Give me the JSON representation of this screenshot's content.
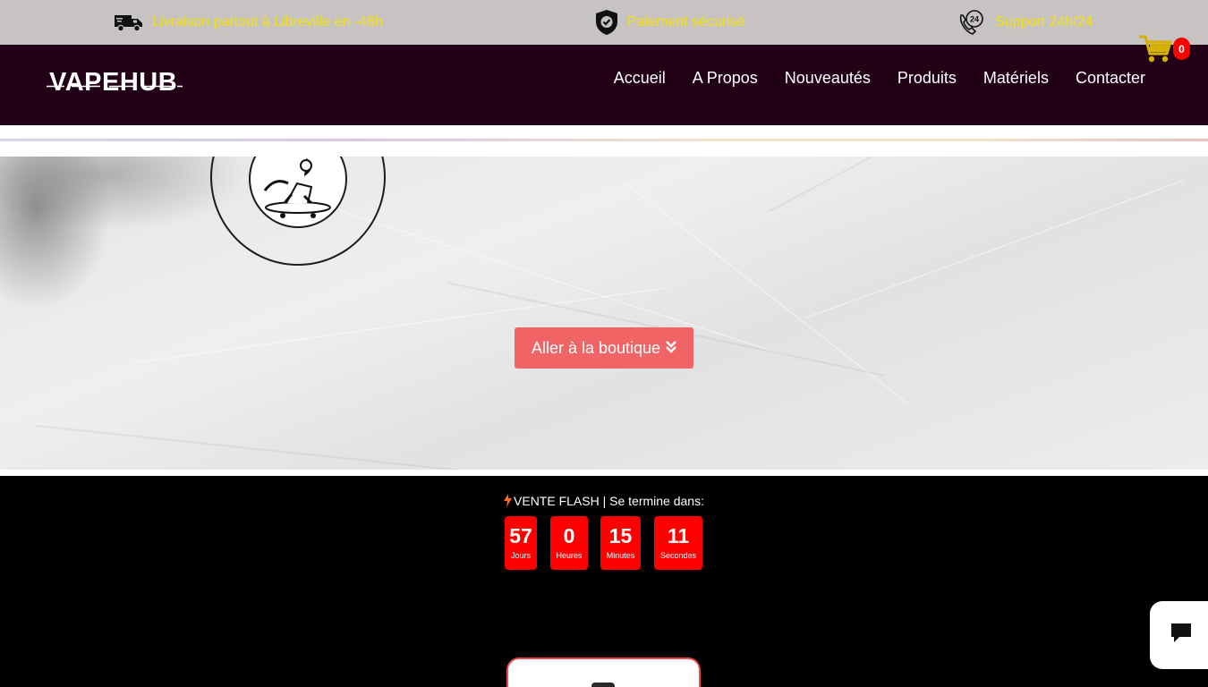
{
  "topbar": {
    "delivery": "Livraison partout à Libreville en -48h",
    "payment": "Paiement sécurisé",
    "support": "Support 24h/24",
    "support_icon_text": "24",
    "text_color": "#f5e10a",
    "background": "#c7c3c3"
  },
  "header": {
    "logo": "VAPEHUB",
    "background": "#220018",
    "nav": [
      "Accueil",
      "A Propos",
      "Nouveautés",
      "Produits",
      "Matériels",
      "Contacter"
    ],
    "cart_count": "0",
    "cart_icon": "cart-icon"
  },
  "hero": {
    "cta_label": "Aller à la boutique",
    "cta_icon": "double-chevron-down-icon",
    "cta_color": "#f06466"
  },
  "flash_sale": {
    "title": "VENTE FLASH",
    "separator": "|",
    "subtitle": "Se termine dans:",
    "icon": "bolt-icon",
    "countdown": [
      {
        "value": "57",
        "label": "Jours"
      },
      {
        "value": "0",
        "label": "Heures"
      },
      {
        "value": "15",
        "label": "Minutes"
      },
      {
        "value": "11",
        "label": "Secondes"
      }
    ],
    "box_color": "#ff0000"
  },
  "chat": {
    "icon": "chat-bubble-icon"
  }
}
